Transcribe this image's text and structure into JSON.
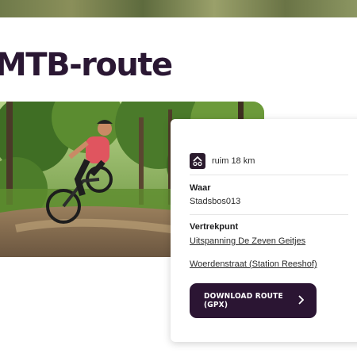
{
  "page": {
    "title": "MTB-route"
  },
  "hero_image": {
    "icon": "mountain-biker-photo"
  },
  "info_card": {
    "distance": {
      "icon": "cycling-route-icon",
      "text": "ruim 18 km"
    },
    "location": {
      "label": "Waar",
      "value": "Stadsbos013"
    },
    "start_point": {
      "label": "Vertrekpunt",
      "links": [
        "Uitspanning De Zeven Geitjes",
        "Woerdenstraat (Station Reeshof)"
      ]
    },
    "download_button": {
      "label": "DOWNLOAD ROUTE (GPX)",
      "icon": "chevron-right-icon"
    }
  },
  "colors": {
    "brand_dark": "#2b1533",
    "title_color": "#2a1733"
  }
}
